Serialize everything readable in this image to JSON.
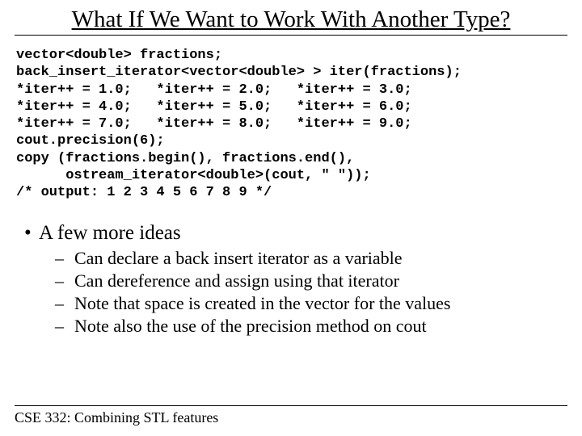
{
  "title": "What If We Want to Work With Another Type?",
  "code": "vector<double> fractions;\nback_insert_iterator<vector<double> > iter(fractions);\n*iter++ = 1.0;   *iter++ = 2.0;   *iter++ = 3.0;\n*iter++ = 4.0;   *iter++ = 5.0;   *iter++ = 6.0;\n*iter++ = 7.0;   *iter++ = 8.0;   *iter++ = 9.0;\ncout.precision(6);\ncopy (fractions.begin(), fractions.end(), \n      ostream_iterator<double>(cout, \" \"));\n/* output: 1 2 3 4 5 6 7 8 9 */",
  "bullet": "A few more ideas",
  "subbullets": [
    "Can declare a back insert iterator as a variable",
    "Can dereference and assign using that iterator",
    "Note that space is created in the vector for the values",
    "Note also the use of the precision method on cout"
  ],
  "footer": "CSE 332: Combining STL features"
}
